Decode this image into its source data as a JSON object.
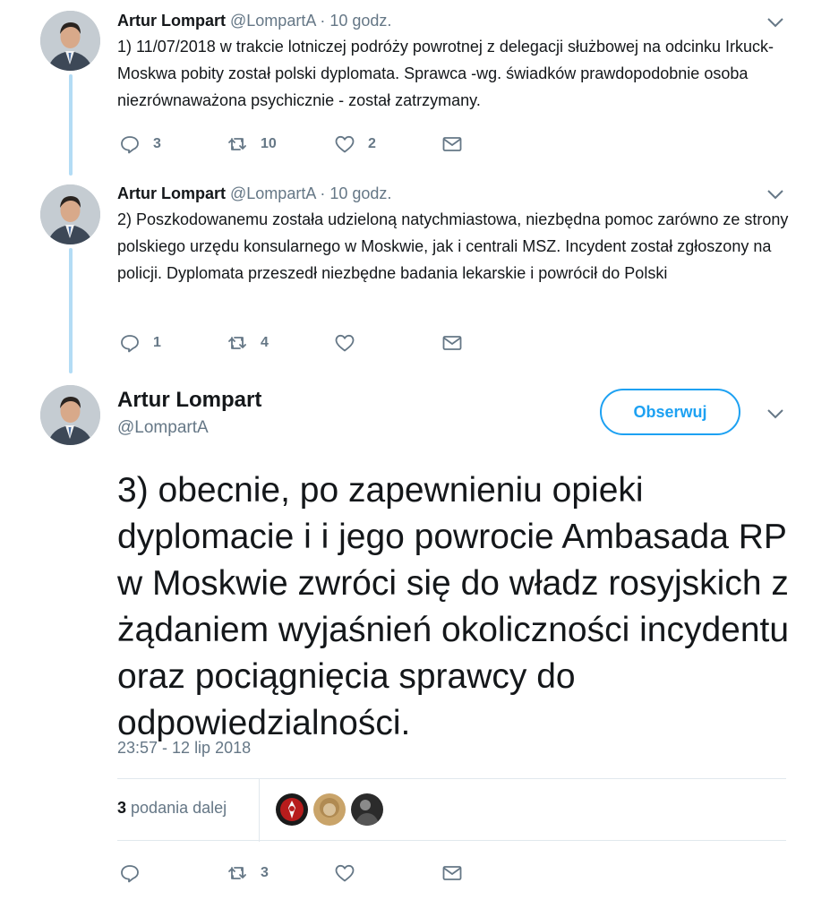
{
  "tweets": [
    {
      "name": "Artur Lompart",
      "handle": "@LompartA",
      "separator": "·",
      "time": "10 godz.",
      "text": "1) 11/07/2018 w trakcie lotniczej podróży powrotnej z delegacji służbowej na odcinku Irkuck-Moskwa pobity został polski dyplomata. Sprawca -wg. świadków prawdopodobnie osoba niezrównaważona psychicznie - został zatrzymany.",
      "replies": "3",
      "retweets": "10",
      "likes": "2"
    },
    {
      "name": "Artur Lompart",
      "handle": "@LompartA",
      "separator": "·",
      "time": "10 godz.",
      "text": "2) Poszkodowanemu została udzieloną natychmiastowa, niezbędna pomoc zarówno ze strony polskiego urzędu konsularnego w Moskwie, jak i centrali MSZ. Incydent został zgłoszony na policji. Dyplomata przeszedł niezbędne badania lekarskie i powrócił do Polski",
      "replies": "1",
      "retweets": "4",
      "likes": ""
    }
  ],
  "main_tweet": {
    "name": "Artur Lompart",
    "handle": "@LompartA",
    "follow_label": "Obserwuj",
    "text": "3) obecnie, po zapewnieniu opieki dyplomacie i i jego powrocie Ambasada RP w Moskwie zwróci się do władz rosyjskich z żądaniem wyjaśnień okoliczności incydentu oraz pociągnięcia sprawcy do odpowiedzialności.",
    "timestamp": "23:57 - 12 lip 2018",
    "retweet_count": "3",
    "retweet_label": "podania dalej",
    "replies": "",
    "retweets": "3",
    "likes": ""
  },
  "icons": {
    "reply": "reply-icon",
    "retweet": "retweet-icon",
    "like": "heart-icon",
    "dm": "envelope-icon",
    "more": "chevron-down-icon"
  },
  "colors": {
    "accent": "#1da1f2",
    "text": "#14171a",
    "secondary": "#657786",
    "thread_line": "#b3dcf5",
    "divider": "#e1e8ed"
  }
}
